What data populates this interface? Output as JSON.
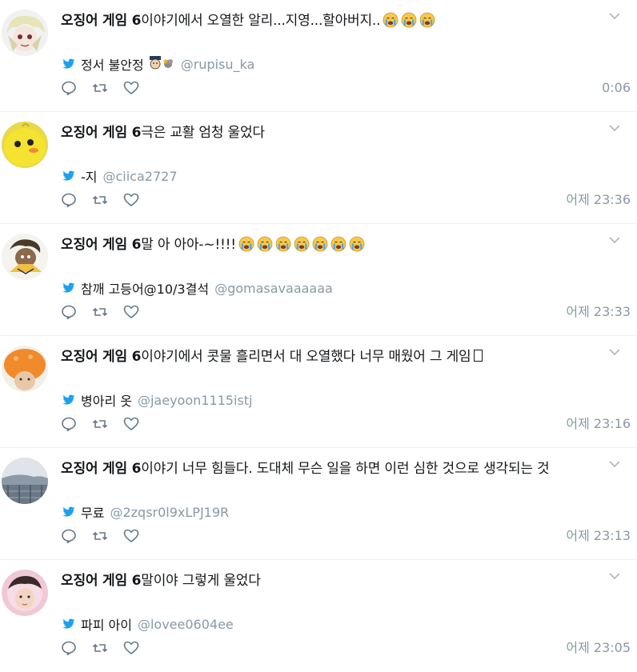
{
  "tweets": [
    {
      "title": "오징어 게임 6",
      "text": "이야기에서 오열한 알리...지영...할아버지..",
      "source_name": "정서 불안정",
      "handle": "@rupisu_ka",
      "time": "0:06",
      "emoji": "crying-face",
      "emoji_count": 3
    },
    {
      "title": "오징어 게임 6",
      "text": "극은 교활 엄청 울었다",
      "source_name": "-지",
      "handle": "@ciica2727",
      "time": "어제 23:36"
    },
    {
      "title": "오징어 게임 6",
      "text": "말 아 아아-~!!!!",
      "source_name": "참깨 고등어@10/3결석",
      "handle": "@gomasavaaaaaa",
      "time": "어제 23:33",
      "emoji": "crying-face",
      "emoji_count": 7
    },
    {
      "title": "오징어 게임 6",
      "text": "이야기에서 콧물 흘리면서 대 오열했다 너무 매웠어 그 게임",
      "source_name": "병아리 옷",
      "handle": "@jaeyoon1115istj",
      "time": "어제 23:16"
    },
    {
      "title": "오징어 게임 6",
      "text": "이야기 너무 힘들다. 도대체 무슨 일을 하면 이런 심한 것으로 생각되는 것",
      "source_name": "무료",
      "handle": "@2zqsr0l9xLPJ19R",
      "time": "어제 23:13"
    },
    {
      "title": "오징어 게임 6",
      "text": "말이야 그렇게 울었다",
      "source_name": "파피 아이",
      "handle": "@lovee0604ee",
      "time": "어제 23:05"
    }
  ],
  "colors": {
    "text": "#14171a",
    "muted": "#8899a6",
    "twitter_blue": "#1da1f2",
    "divider": "#e6ecf0"
  },
  "icons": [
    "reply-icon",
    "retweet-icon",
    "like-icon",
    "twitter-bird-icon",
    "chevron-down-icon",
    "crying-face-emoji"
  ]
}
